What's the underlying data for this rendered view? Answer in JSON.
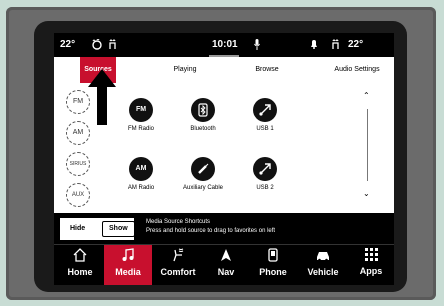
{
  "status": {
    "left_temp": "22°",
    "time": "10:01",
    "right_temp": "22°"
  },
  "tabs": [
    {
      "label": "Sources",
      "active": true
    },
    {
      "label": "Playing",
      "active": false
    },
    {
      "label": "Browse",
      "active": false
    },
    {
      "label": "Audio Settings",
      "active": false
    }
  ],
  "favorites": [
    "FM",
    "AM",
    "SIRIUS",
    "AUX"
  ],
  "sources": [
    {
      "icon": "FM",
      "label": "FM Radio"
    },
    {
      "icon": "bluetooth-icon",
      "label": "Bluetooth"
    },
    {
      "icon": "usb-icon",
      "label": "USB 1"
    },
    {
      "icon": "AM",
      "label": "AM Radio"
    },
    {
      "icon": "aux-icon",
      "label": "Auxiliary Cable"
    },
    {
      "icon": "usb-icon",
      "label": "USB 2"
    }
  ],
  "shortcuts": {
    "hide_label": "Hide",
    "show_label": "Show",
    "title": "Media Source Shortcuts",
    "hint": "Press and hold source to drag to favorites on left"
  },
  "nav": [
    {
      "label": "Home",
      "icon": "home-icon",
      "active": false
    },
    {
      "label": "Media",
      "icon": "music-note-icon",
      "active": true
    },
    {
      "label": "Comfort",
      "icon": "seat-fan-icon",
      "active": false
    },
    {
      "label": "Nav",
      "icon": "navigation-arrow-icon",
      "active": false
    },
    {
      "label": "Phone",
      "icon": "phone-icon",
      "active": false
    },
    {
      "label": "Vehicle",
      "icon": "car-icon",
      "active": false
    },
    {
      "label": "Apps",
      "icon": "grid-icon",
      "active": false
    }
  ],
  "colors": {
    "accent": "#c8102e"
  }
}
